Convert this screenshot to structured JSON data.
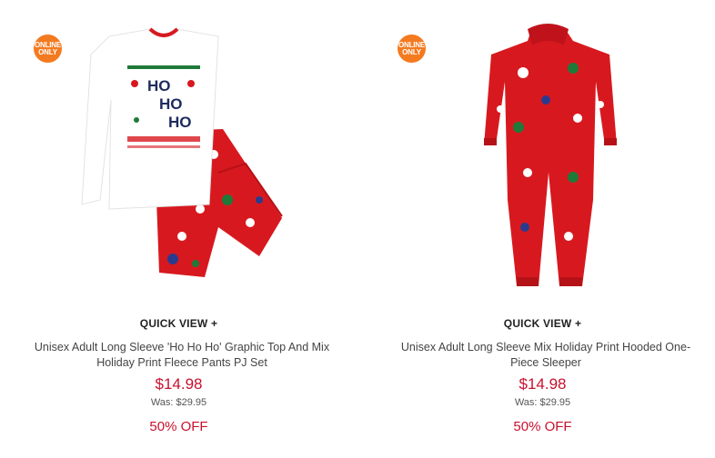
{
  "products": [
    {
      "badge": [
        "ONLINE",
        "ONLY"
      ],
      "quick_view": "QUICK VIEW +",
      "title": "Unisex Adult Long Sleeve 'Ho Ho Ho' Graphic Top And Mix Holiday Print Fleece Pants PJ Set",
      "price": "$14.98",
      "was": "Was: $29.95",
      "discount": "50% OFF",
      "graphic_text": [
        "HO",
        "HO",
        "HO"
      ]
    },
    {
      "badge": [
        "ONLINE",
        "ONLY"
      ],
      "quick_view": "QUICK VIEW +",
      "title": "Unisex Adult Long Sleeve Mix Holiday Print Hooded One-Piece Sleeper",
      "price": "$14.98",
      "was": "Was: $29.95",
      "discount": "50% OFF"
    }
  ],
  "colors": {
    "accent_red": "#c8102e",
    "badge_orange": "#f47a20",
    "garment_red": "#d7191f"
  }
}
